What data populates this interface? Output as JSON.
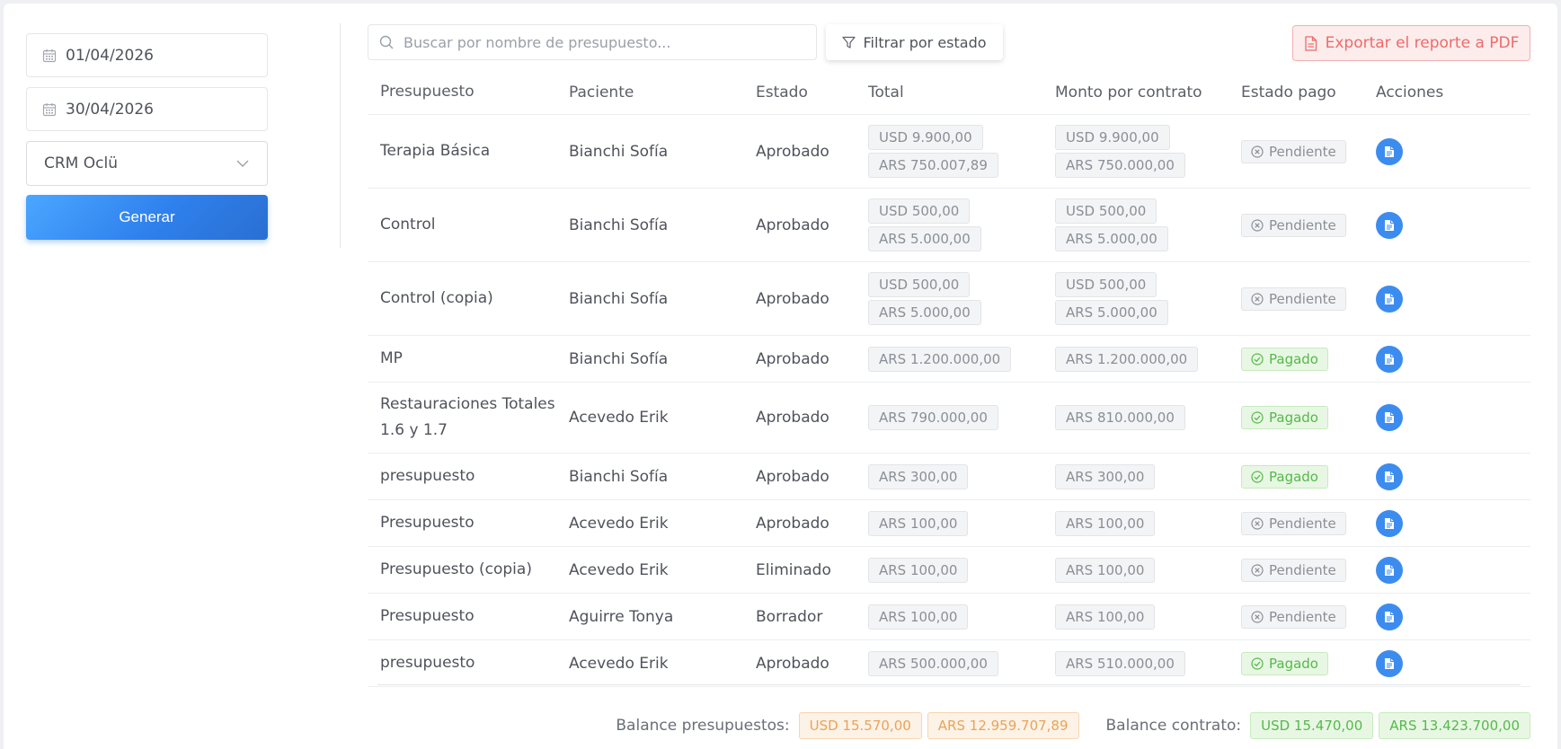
{
  "filters": {
    "date_from": "01/04/2026",
    "date_to": "30/04/2026",
    "selected_option": "CRM Oclü",
    "generate_label": "Generar"
  },
  "toolbar": {
    "search_placeholder": "Buscar por nombre de presupuesto...",
    "filter_label": "Filtrar por estado",
    "export_label": "Exportar el reporte a PDF"
  },
  "table": {
    "headers": [
      "Presupuesto",
      "Paciente",
      "Estado",
      "Total",
      "Monto por contrato",
      "Estado pago",
      "Acciones"
    ],
    "rows": [
      {
        "name": "Terapia Básica",
        "patient": "Bianchi Sofía",
        "state": "Aprobado",
        "total": [
          "USD 9.900,00",
          "ARS 750.007,89"
        ],
        "contract": [
          "USD 9.900,00",
          "ARS 750.000,00"
        ],
        "payment": "Pendiente",
        "paid": false
      },
      {
        "name": "Control",
        "patient": "Bianchi Sofía",
        "state": "Aprobado",
        "total": [
          "USD 500,00",
          "ARS 5.000,00"
        ],
        "contract": [
          "USD 500,00",
          "ARS 5.000,00"
        ],
        "payment": "Pendiente",
        "paid": false
      },
      {
        "name": "Control (copia)",
        "patient": "Bianchi Sofía",
        "state": "Aprobado",
        "total": [
          "USD 500,00",
          "ARS 5.000,00"
        ],
        "contract": [
          "USD 500,00",
          "ARS 5.000,00"
        ],
        "payment": "Pendiente",
        "paid": false
      },
      {
        "name": "MP",
        "patient": "Bianchi Sofía",
        "state": "Aprobado",
        "total": [
          "ARS 1.200.000,00"
        ],
        "contract": [
          "ARS 1.200.000,00"
        ],
        "payment": "Pagado",
        "paid": true
      },
      {
        "name": "Restauraciones Totales 1.6 y 1.7",
        "patient": "Acevedo Erik",
        "state": "Aprobado",
        "total": [
          "ARS 790.000,00"
        ],
        "contract": [
          "ARS 810.000,00"
        ],
        "payment": "Pagado",
        "paid": true
      },
      {
        "name": "presupuesto",
        "patient": "Bianchi Sofía",
        "state": "Aprobado",
        "total": [
          "ARS 300,00"
        ],
        "contract": [
          "ARS 300,00"
        ],
        "payment": "Pagado",
        "paid": true
      },
      {
        "name": "Presupuesto",
        "patient": "Acevedo Erik",
        "state": "Aprobado",
        "total": [
          "ARS 100,00"
        ],
        "contract": [
          "ARS 100,00"
        ],
        "payment": "Pendiente",
        "paid": false
      },
      {
        "name": "Presupuesto (copia)",
        "patient": "Acevedo Erik",
        "state": "Eliminado",
        "total": [
          "ARS 100,00"
        ],
        "contract": [
          "ARS 100,00"
        ],
        "payment": "Pendiente",
        "paid": false
      },
      {
        "name": "Presupuesto",
        "patient": "Aguirre Tonya",
        "state": "Borrador",
        "total": [
          "ARS 100,00"
        ],
        "contract": [
          "ARS 100,00"
        ],
        "payment": "Pendiente",
        "paid": false
      },
      {
        "name": "presupuesto",
        "patient": "Acevedo Erik",
        "state": "Aprobado",
        "total": [
          "ARS 500.000,00"
        ],
        "contract": [
          "ARS 510.000,00"
        ],
        "payment": "Pagado",
        "paid": true
      }
    ]
  },
  "footer": {
    "balance_budget_label": "Balance presupuestos:",
    "balance_budget_usd": "USD 15.570,00",
    "balance_budget_ars": "ARS 12.959.707,89",
    "balance_contract_label": "Balance contrato:",
    "balance_contract_usd": "USD 15.470,00",
    "balance_contract_ars": "ARS 13.423.700,00"
  },
  "icons": {
    "date": "calendar-icon",
    "select": "chevron-down-icon",
    "search": "search-icon",
    "filter": "funnel-icon",
    "export": "pdf-file-icon",
    "pending": "circle-x-icon",
    "paid": "circle-check-icon",
    "action": "document-icon"
  },
  "colors": {
    "primary": "#3c8cf0",
    "danger": "#ef6a6a",
    "success": "#55b94a",
    "warning": "#e9a35a"
  }
}
